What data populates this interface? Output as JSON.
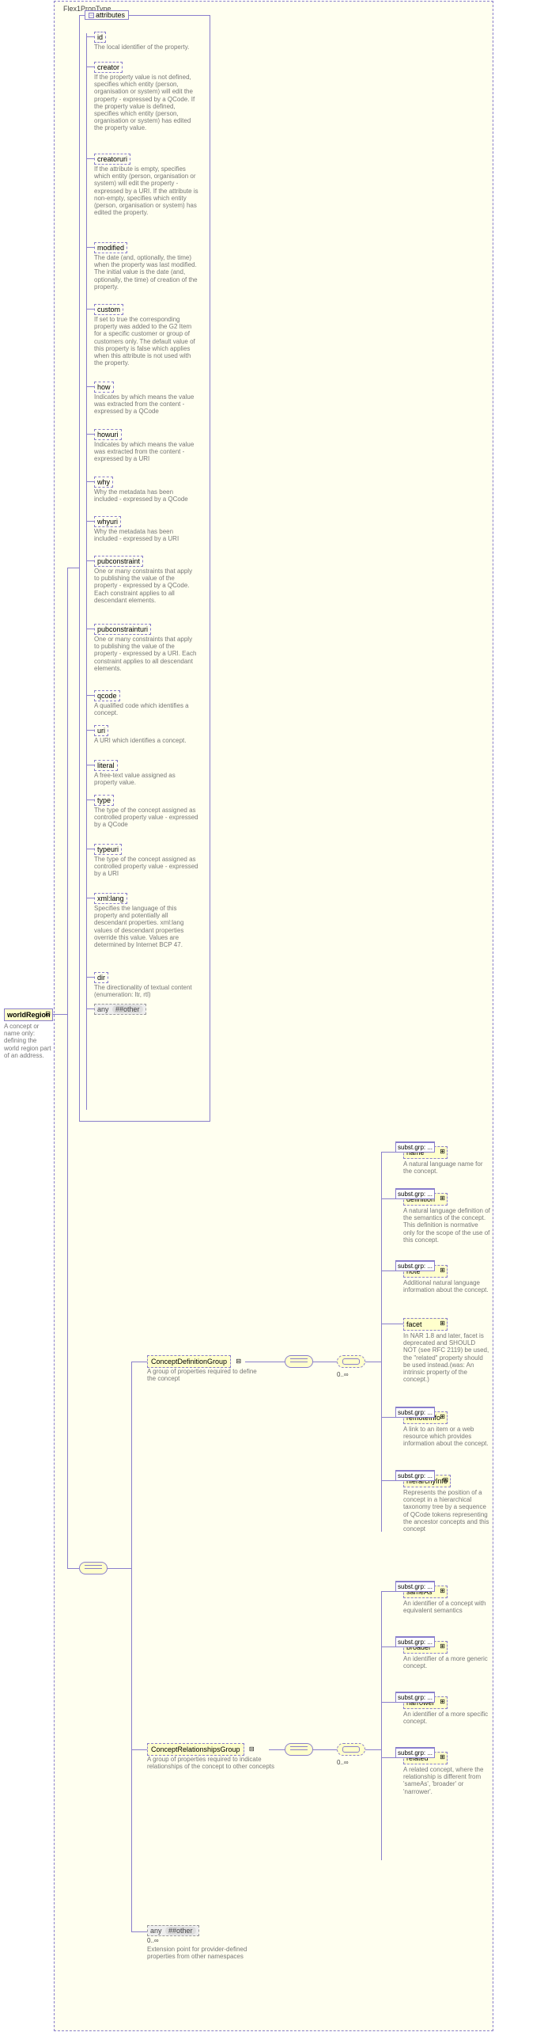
{
  "root_type_label": "Flex1PropType",
  "root_element": {
    "name": "worldRegion",
    "desc": "A concept or name only: defining the world region part of an address."
  },
  "attributes_label": "attributes",
  "attributes": [
    {
      "name": "id",
      "desc": "The local identifier of the property."
    },
    {
      "name": "creator",
      "desc": "If the property value is not defined, specifies which entity (person, organisation or system) will edit the property - expressed by a QCode. If the property value is defined, specifies which entity (person, organisation or system) has edited the property value."
    },
    {
      "name": "creatoruri",
      "desc": "If the attribute is empty, specifies which entity (person, organisation or system) will edit the property - expressed by a URI. If the attribute is non-empty, specifies which entity (person, organisation or system) has edited the property."
    },
    {
      "name": "modified",
      "desc": "The date (and, optionally, the time) when the property was last modified. The initial value is the date (and, optionally, the time) of creation of the property."
    },
    {
      "name": "custom",
      "desc": "If set to true the corresponding property was added to the G2 Item for a specific customer or group of customers only. The default value of this property is false which applies when this attribute is not used with the property."
    },
    {
      "name": "how",
      "desc": "Indicates by which means the value was extracted from the content - expressed by a QCode"
    },
    {
      "name": "howuri",
      "desc": "Indicates by which means the value was extracted from the content - expressed by a URI"
    },
    {
      "name": "why",
      "desc": "Why the metadata has been included - expressed by a QCode"
    },
    {
      "name": "whyuri",
      "desc": "Why the metadata has been included - expressed by a URI"
    },
    {
      "name": "pubconstraint",
      "desc": "One or many constraints that apply to publishing the value of the property - expressed by a QCode. Each constraint applies to all descendant elements."
    },
    {
      "name": "pubconstrainturi",
      "desc": "One or many constraints that apply to publishing the value of the property - expressed by a URI. Each constraint applies to all descendant elements."
    },
    {
      "name": "qcode",
      "desc": "A qualified code which identifies a concept."
    },
    {
      "name": "uri",
      "desc": "A URI which identifies a concept."
    },
    {
      "name": "literal",
      "desc": "A free-text value assigned as property value."
    },
    {
      "name": "type",
      "desc": "The type of the concept assigned as controlled property value - expressed by a QCode"
    },
    {
      "name": "typeuri",
      "desc": "The type of the concept assigned as controlled property value - expressed by a URI"
    },
    {
      "name": "xml:lang",
      "desc": "Specifies the language of this property and potentially all descendant properties. xml:lang values of descendant properties override this value. Values are determined by Internet BCP 47."
    },
    {
      "name": "dir",
      "desc": "The directionality of textual content (enumeration: ltr, rtl)"
    }
  ],
  "attributes_any": {
    "any": "any",
    "ns": "##other"
  },
  "groups": {
    "definition": {
      "label": "ConceptDefinitionGroup",
      "desc": "A group of properties required to define the concept",
      "card": "0..∞"
    },
    "relationships": {
      "label": "ConceptRelationshipsGroup",
      "desc": "A group of properties required to indicate relationships of the concept to other concepts",
      "card": "0..∞"
    }
  },
  "definition_children": [
    {
      "name": "name",
      "desc": "A natural language name for the concept."
    },
    {
      "name": "definition",
      "desc": "A natural language definition of the semantics of the concept. This definition is normative only for the scope of the use of this concept."
    },
    {
      "name": "note",
      "desc": "Additional natural language information about the concept."
    },
    {
      "name": "facet",
      "desc": "In NAR 1.8 and later, facet is deprecated and SHOULD NOT (see RFC 2119) be used, the \"related\" property should be used instead.(was: An intrinsic property of the concept.)"
    },
    {
      "name": "remoteInfo",
      "desc": "A link to an item or a web resource which provides information about the concept."
    },
    {
      "name": "hierarchyInfo",
      "desc": "Represents the position of a concept in a hierarchical taxonomy tree by a sequence of QCode tokens representing the ancestor concepts and this concept"
    }
  ],
  "relationships_children": [
    {
      "name": "sameAs",
      "desc": "An identifier of a concept with equivalent semantics"
    },
    {
      "name": "broader",
      "desc": "An identifier of a more generic concept."
    },
    {
      "name": "narrower",
      "desc": "An identifier of a more specific concept."
    },
    {
      "name": "related",
      "desc": "A related concept, where the relationship is different from 'sameAs', 'broader' or 'narrower'."
    }
  ],
  "bottom_any": {
    "any": "any",
    "ns": "##other",
    "card": "0..∞",
    "desc": "Extension point for provider-defined properties from other namespaces"
  },
  "note_label": "subst.grp: ..."
}
